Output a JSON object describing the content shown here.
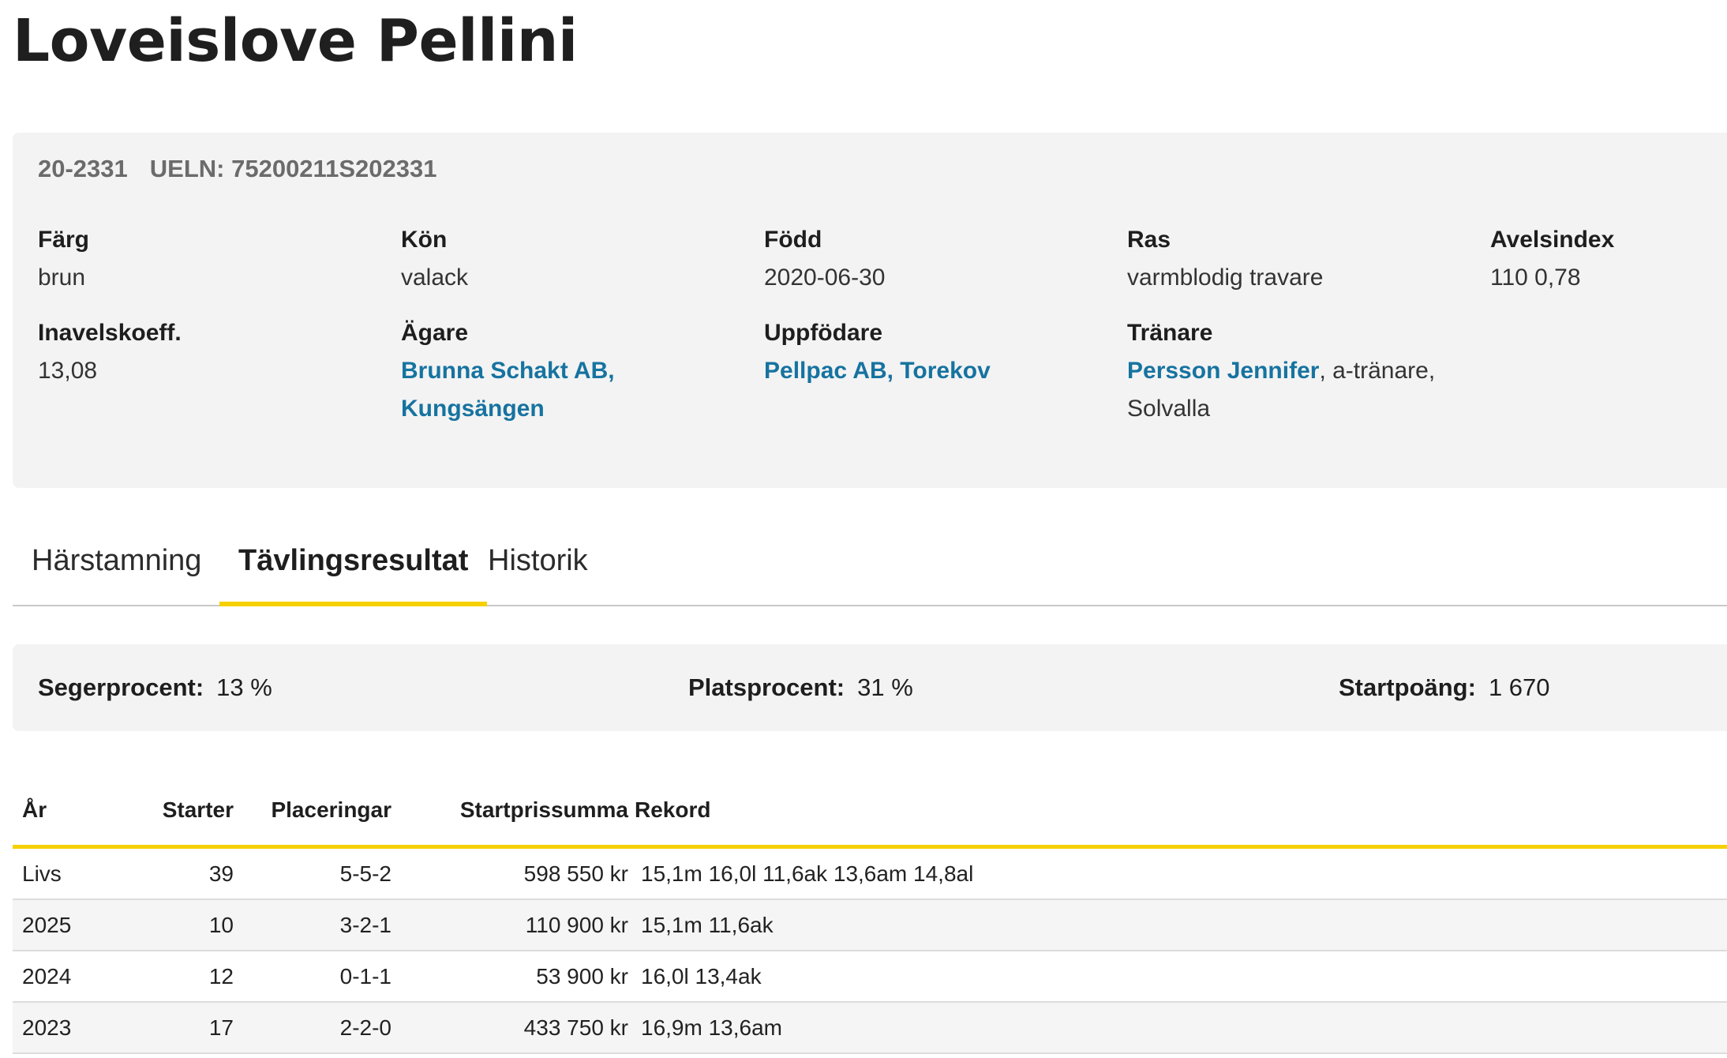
{
  "horse": {
    "name": "Loveislove Pellini",
    "reg_no": "20-2331",
    "ueln": "UELN: 75200211S202331"
  },
  "info": {
    "farg": {
      "label": "Färg",
      "value": "brun"
    },
    "kon": {
      "label": "Kön",
      "value": "valack"
    },
    "fodd": {
      "label": "Född",
      "value": "2020-06-30"
    },
    "ras": {
      "label": "Ras",
      "value": "varmblodig travare"
    },
    "avelsindex": {
      "label": "Avelsindex",
      "value": "110 0,78"
    },
    "inavel": {
      "label": "Inavelskoeff.",
      "value": "13,08"
    },
    "agare": {
      "label": "Ägare",
      "line1": "Brunna Schakt AB,",
      "line2": "Kungsängen"
    },
    "uppfodare": {
      "label": "Uppfödare",
      "value": "Pellpac AB, Torekov"
    },
    "tranare": {
      "label": "Tränare",
      "name": "Persson Jennifer",
      "suffix": ", a-tränare,",
      "line2": "Solvalla"
    }
  },
  "tabs": [
    {
      "label": "Härstamning",
      "active": false
    },
    {
      "label": "Tävlingsresultat",
      "active": true
    },
    {
      "label": "Historik",
      "active": false
    }
  ],
  "stats": {
    "seger": {
      "label": "Segerprocent:",
      "value": "13 %"
    },
    "plats": {
      "label": "Platsprocent:",
      "value": "31 %"
    },
    "startpoang": {
      "label": "Startpoäng:",
      "value": "1 670"
    }
  },
  "table": {
    "headers": {
      "year": "År",
      "starts": "Starter",
      "places": "Placeringar",
      "prize": "Startprissumma",
      "record": "Rekord"
    },
    "rows": [
      {
        "year": "Livs",
        "starts": "39",
        "places": "5-5-2",
        "prize": "598 550 kr",
        "record": "15,1m 16,0l 11,6ak 13,6am 14,8al"
      },
      {
        "year": "2025",
        "starts": "10",
        "places": "3-2-1",
        "prize": "110 900 kr",
        "record": "15,1m 11,6ak"
      },
      {
        "year": "2024",
        "starts": "12",
        "places": "0-1-1",
        "prize": "53 900 kr",
        "record": "16,0l 13,4ak"
      },
      {
        "year": "2023",
        "starts": "17",
        "places": "2-2-0",
        "prize": "433 750 kr",
        "record": "16,9m 13,6am"
      }
    ]
  },
  "colors": {
    "accent": "#f6d000",
    "link": "#1673a0",
    "card": "#f3f3f3"
  }
}
